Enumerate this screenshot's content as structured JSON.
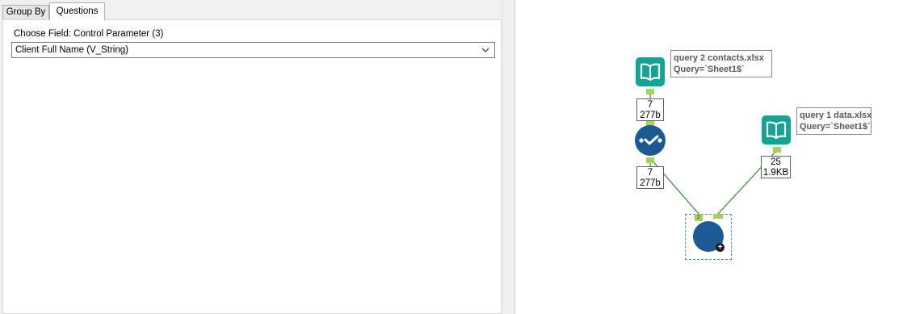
{
  "config_panel": {
    "tabs": [
      {
        "label": "Group By",
        "selected": false
      },
      {
        "label": "Questions",
        "selected": true
      }
    ],
    "field_label": "Choose Field: Control Parameter (3)",
    "field_value": "Client Full Name (V_String)"
  },
  "canvas": {
    "input_tool_1": {
      "icon": "book-icon",
      "annotation_line1": "query 2 contacts.xlsx",
      "annotation_line2": "Query=`Sheet1$`",
      "record_count": "7",
      "record_size": "277b"
    },
    "select_tool": {
      "icon": "checkmark-icon",
      "record_count": "7",
      "record_size": "277b"
    },
    "input_tool_2": {
      "icon": "book-icon",
      "annotation_line1": "query 1 data.xlsx",
      "annotation_line2": "Query=`Sheet1$`",
      "record_count": "25",
      "record_size": "1.9KB"
    },
    "macro_tool": {
      "icon": "plus-badge-icon",
      "plus_glyph": "+",
      "input_anchor_label": "2"
    }
  },
  "colors": {
    "input_tool": "#12a593",
    "select_tool": "#1c5a96",
    "connector": "#2e8b2e",
    "anchor": "#a6d25a"
  }
}
